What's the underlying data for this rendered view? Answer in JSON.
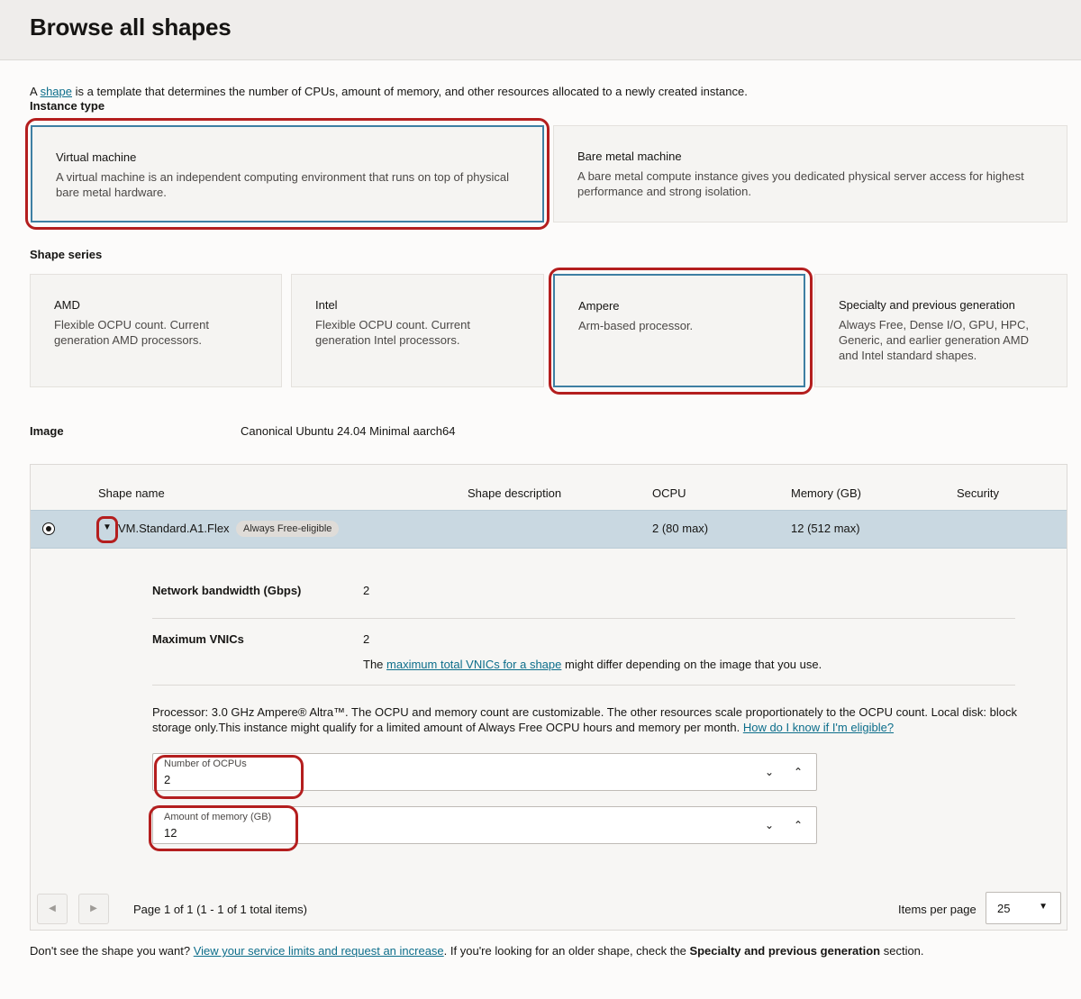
{
  "page": {
    "title": "Browse all shapes",
    "intro_prefix": "A ",
    "intro_link": "shape",
    "intro_suffix": " is a template that determines the number of CPUs, amount of memory, and other resources allocated to a newly created instance."
  },
  "instance_type": {
    "label": "Instance type",
    "options": [
      {
        "title": "Virtual machine",
        "description": "A virtual machine is an independent computing environment that runs on top of physical bare metal hardware.",
        "selected": true
      },
      {
        "title": "Bare metal machine",
        "description": "A bare metal compute instance gives you dedicated physical server access for highest performance and strong isolation.",
        "selected": false
      }
    ]
  },
  "shape_series": {
    "label": "Shape series",
    "options": [
      {
        "title": "AMD",
        "description": "Flexible OCPU count. Current generation AMD processors.",
        "selected": false
      },
      {
        "title": "Intel",
        "description": "Flexible OCPU count. Current generation Intel processors.",
        "selected": false
      },
      {
        "title": "Ampere",
        "description": "Arm-based processor.",
        "selected": true
      },
      {
        "title": "Specialty and previous generation",
        "description": "Always Free, Dense I/O, GPU, HPC, Generic, and earlier generation AMD and Intel standard shapes.",
        "selected": false
      }
    ]
  },
  "image": {
    "label": "Image",
    "value": "Canonical Ubuntu 24.04 Minimal aarch64"
  },
  "table": {
    "columns": [
      "Shape name",
      "Shape description",
      "OCPU",
      "Memory (GB)",
      "Security"
    ],
    "rows": [
      {
        "name": "VM.Standard.A1.Flex",
        "badge": "Always Free-eligible",
        "description": "",
        "ocpu": "2 (80 max)",
        "memory": "12 (512 max)",
        "security": ""
      }
    ],
    "details": {
      "network_label": "Network bandwidth (Gbps)",
      "network_value": "2",
      "vnics_label": "Maximum VNICs",
      "vnics_value": "2",
      "vnics_note_prefix": "The ",
      "vnics_note_link": "maximum total VNICs for a shape",
      "vnics_note_suffix": " might differ depending on the image that you use.",
      "processor_text": "Processor: 3.0 GHz Ampere® Altra™. The OCPU and memory count are customizable. The other resources scale proportionately to the OCPU count. Local disk: block storage only.This instance might qualify for a limited amount of Always Free OCPU hours and memory per month. ",
      "processor_link": "How do I know if I'm eligible?",
      "ocpu_field": {
        "label": "Number of OCPUs",
        "value": "2"
      },
      "memory_field": {
        "label": "Amount of memory (GB)",
        "value": "12"
      }
    },
    "pagination": {
      "prev_icon": "◀",
      "next_icon": "▶",
      "text": "Page 1 of 1 (1 - 1 of 1 total items)",
      "items_per_page_label": "Items per page",
      "items_per_page_value": "25"
    }
  },
  "footer": {
    "prefix": "Don't see the shape you want? ",
    "link": "View your service limits and request an increase",
    "middle": ". If you're looking for an older shape, check the ",
    "bold": "Specialty and previous generation",
    "suffix": " section."
  },
  "colors": {
    "highlight": "#b41e1e",
    "selected_border": "#3e7fa3",
    "link": "#0d6e8b",
    "selected_row": "#c9d8e1"
  }
}
